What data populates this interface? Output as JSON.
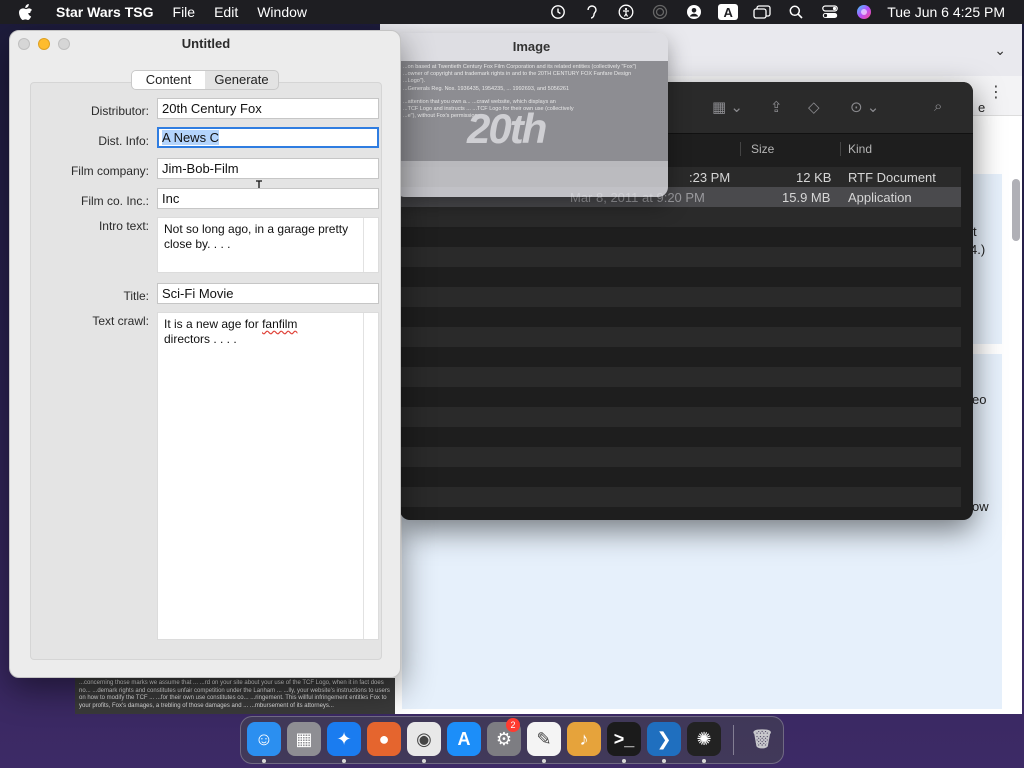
{
  "menubar": {
    "app_name": "Star Wars TSG",
    "menus": [
      "File",
      "Edit",
      "Window"
    ],
    "input_source": "A",
    "clock": "Tue Jun 6  4:25 PM"
  },
  "bgpage": {
    "snippets": [
      "e",
      "t",
      "4.)",
      "eo",
      "ow"
    ]
  },
  "image_window": {
    "title": "Image",
    "fine_print": [
      "...on based at Twentieth Century Fox Film Corporation and its related entities (collectively \"Fox\")",
      "...owner of copyright and trademark rights in and to the 20TH CENTURY FOX Fanfare Design",
      "...Logo\").",
      "...Generals Reg. Nos. 1936435, 1954235, ... 1992693, and 5056261",
      "...attention that you own a...          ...crawl website, which displays an",
      "...TCF Logo and instructs ...          ...TCF Logo for their own use (collectively",
      "...e\"), without Fox's permission..."
    ],
    "logo_text": "20th"
  },
  "finder": {
    "columns": {
      "size": "Size",
      "kind": "Kind"
    },
    "rows": [
      {
        "date": ":23 PM",
        "size": "12 KB",
        "kind": "RTF Document",
        "selected": false
      },
      {
        "date": "Mar 8, 2011 at 9:20 PM",
        "size": "15.9 MB",
        "kind": "Application",
        "selected": true
      }
    ]
  },
  "app_window": {
    "title": "Untitled",
    "tabs": [
      {
        "label": "Content",
        "active": true
      },
      {
        "label": "Generate",
        "active": false
      }
    ],
    "fields": {
      "distributor": {
        "label": "Distributor:",
        "value": "20th Century Fox"
      },
      "dist_info": {
        "label": "Dist. Info:",
        "value": "A News C"
      },
      "film_company": {
        "label": "Film company:",
        "value": "Jim-Bob-Film"
      },
      "film_co_inc": {
        "label": "Film co. Inc.:",
        "value": "Inc"
      },
      "intro_text": {
        "label": "Intro text:",
        "line1": "Not so long ago, in a garage pretty",
        "line2": "close by. . . ."
      },
      "title": {
        "label": "Title:",
        "value": "Sci-Fi Movie"
      },
      "text_crawl": {
        "label": "Text crawl:",
        "line1_a": "It is a new age for ",
        "line1_b": "fanfilm",
        "line2": "directors . . . ."
      }
    }
  },
  "behind_strip": {
    "text": "...concerning those marks we assume that ... ...rd on your site about your use of the TCF Logo, when it in fact does no... ...demark rights and constitutes unfair competition under the Lanham ... ...lly, your website's instructions to users on how to modify the TCF ... ...for their own use constitutes co... ...ringement. This willful infringement entitles Fox to your profits, Fox's damages, a trebling of those damages and ... ...mbursement of its attorneys..."
  },
  "dock": {
    "items": [
      {
        "name": "finder",
        "color": "#2b8ff0",
        "glyph": "☺",
        "running": true
      },
      {
        "name": "launchpad",
        "color": "#8e8e93",
        "glyph": "▦",
        "running": false
      },
      {
        "name": "safari",
        "color": "#1a7cf0",
        "glyph": "✦",
        "running": true
      },
      {
        "name": "firefox",
        "color": "#e5652e",
        "glyph": "●",
        "running": false
      },
      {
        "name": "chrome",
        "color": "#e8e8e8",
        "glyph": "◉",
        "running": true
      },
      {
        "name": "app-store",
        "color": "#1c8ef9",
        "glyph": "A",
        "running": false
      },
      {
        "name": "system-settings",
        "color": "#7d7d82",
        "glyph": "⚙",
        "running": false,
        "badge": "2"
      },
      {
        "name": "textedit",
        "color": "#f4f4f4",
        "glyph": "✎",
        "running": true
      },
      {
        "name": "garageband",
        "color": "#e6a33b",
        "glyph": "♪",
        "running": false
      },
      {
        "name": "terminal",
        "color": "#1b1b1b",
        "glyph": ">_",
        "running": true
      },
      {
        "name": "vscode",
        "color": "#1f6fbf",
        "glyph": "❯",
        "running": true
      },
      {
        "name": "star-wars-tsg",
        "color": "#222",
        "glyph": "✺",
        "running": true
      },
      {
        "name": "trash",
        "color": "#9aa0a6",
        "glyph": "🗑",
        "running": false
      }
    ]
  }
}
